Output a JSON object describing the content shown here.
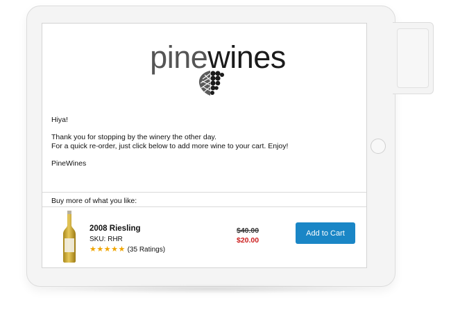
{
  "brand": {
    "logo_light": "pine",
    "logo_dark": "wines",
    "logo_icon": "grape-leaf-icon"
  },
  "email": {
    "greeting": "Hiya!",
    "line1": "Thank you for stopping by the winery the other day.",
    "line2": "For a quick re-order, just click below to add more wine to your cart. Enjoy!",
    "signature": "PineWines"
  },
  "products_section": {
    "title": "Buy more of what you like:",
    "items": [
      {
        "name": "2008 Riesling",
        "sku": "SKU: RHR",
        "stars": "★★★★★",
        "rating_value": 5,
        "ratings": "(35 Ratings)",
        "price_old": "$40.00",
        "price_new": "$20.00",
        "button": "Add to Cart",
        "image_icon": "wine-bottle-icon"
      }
    ]
  },
  "colors": {
    "accent": "#1a86c6",
    "sale": "#cc1e1e",
    "star": "#f0a500"
  }
}
